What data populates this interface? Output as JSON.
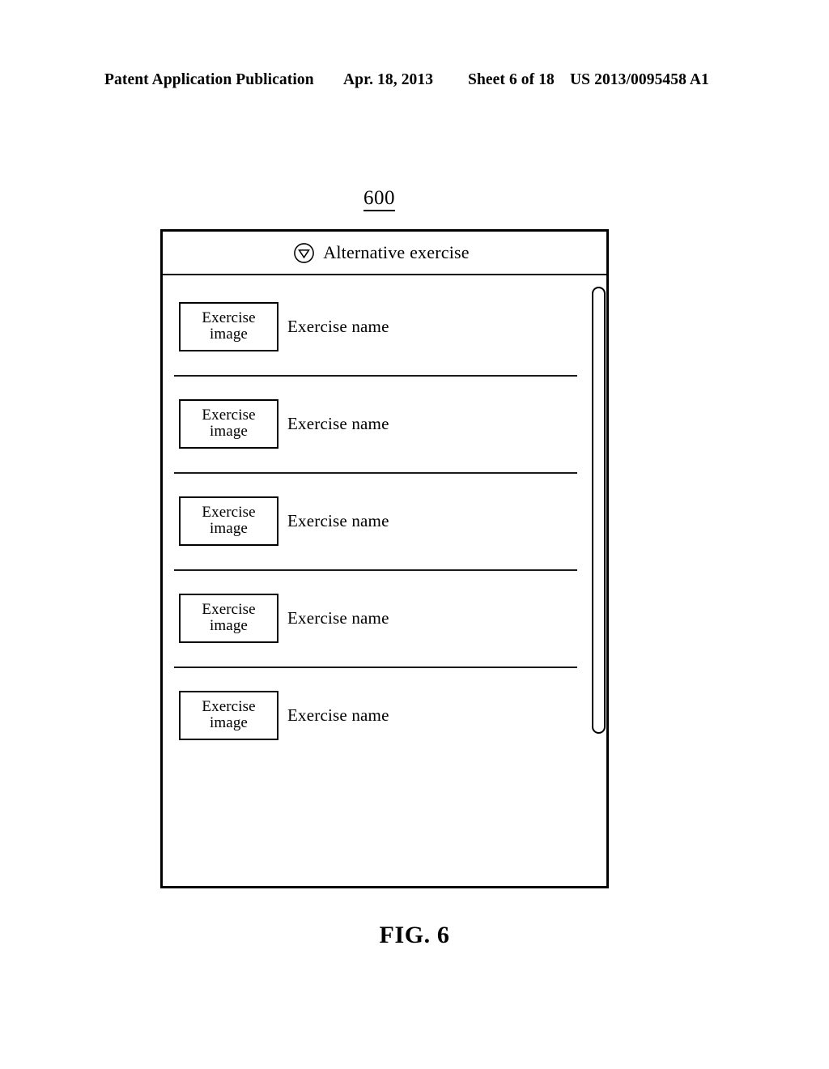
{
  "page_header": {
    "publication": "Patent Application Publication",
    "date": "Apr. 18, 2013",
    "sheet": "Sheet 6 of 18",
    "patent_number": "US 2013/0095458 A1"
  },
  "figure": {
    "reference_number": "600",
    "caption": "FIG. 6"
  },
  "screen": {
    "title_bar": {
      "icon": "dropdown-triangle-circle-icon",
      "title": "Alternative exercise"
    },
    "rows": [
      {
        "thumb_line1": "Exercise",
        "thumb_line2": "image",
        "label": "Exercise name"
      },
      {
        "thumb_line1": "Exercise",
        "thumb_line2": "image",
        "label": "Exercise name"
      },
      {
        "thumb_line1": "Exercise",
        "thumb_line2": "image",
        "label": "Exercise name"
      },
      {
        "thumb_line1": "Exercise",
        "thumb_line2": "image",
        "label": "Exercise name"
      },
      {
        "thumb_line1": "Exercise",
        "thumb_line2": "image",
        "label": "Exercise name"
      }
    ],
    "scrollbar": {
      "name": "vertical-scrollbar"
    }
  },
  "colors": {
    "ink": "#000000",
    "paper": "#ffffff",
    "divider": "#1a1a1a"
  }
}
